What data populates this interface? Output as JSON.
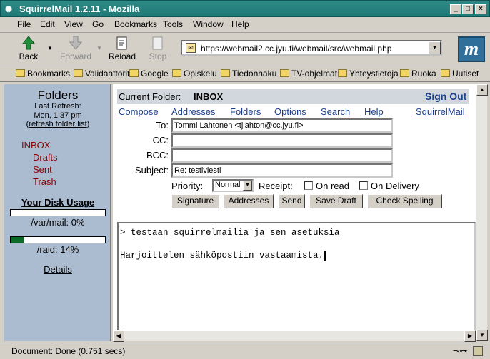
{
  "window": {
    "title": "SquirrelMail 1.2.11 - Mozilla",
    "controls": {
      "minimize": "_",
      "maximize": "□",
      "close": "×"
    }
  },
  "menu": [
    "File",
    "Edit",
    "View",
    "Go",
    "Bookmarks",
    "Tools",
    "Window",
    "Help"
  ],
  "toolbar": {
    "back": "Back",
    "forward": "Forward",
    "reload": "Reload",
    "stop": "Stop",
    "url": "https://webmail2.cc.jyu.fi/webmail/src/webmail.php"
  },
  "bookmarks": [
    "Bookmarks",
    "Validaattorit",
    "Google",
    "Opiskelu",
    "Tiedonhaku",
    "TV-ohjelmat",
    "Yhteystietoja",
    "Ruoka",
    "Uutiset"
  ],
  "sidebar": {
    "title": "Folders",
    "last_refresh_label": "Last Refresh:",
    "last_refresh_time": "Mon, 1:37 pm",
    "refresh_open": "(",
    "refresh_link": "refresh folder list",
    "refresh_close": ")",
    "folders": [
      "INBOX",
      "Drafts",
      "Sent",
      "Trash"
    ],
    "disk_usage_title": "Your Disk Usage",
    "quota1_label": "/var/mail: 0%",
    "quota1_value": 0,
    "quota2_label": "/raid: 14%",
    "quota2_value": 14,
    "details": "Details"
  },
  "header": {
    "current_folder_label": "Current Folder:",
    "current_folder": "INBOX",
    "sign_out": "Sign Out"
  },
  "nav_links": [
    "Compose",
    "Addresses",
    "Folders",
    "Options",
    "Search",
    "Help"
  ],
  "brand_link": "SquirrelMail",
  "compose": {
    "to_label": "To:",
    "to_value": "Tommi Lahtonen <tjlahton@cc.jyu.fi>",
    "cc_label": "CC:",
    "cc_value": "",
    "bcc_label": "BCC:",
    "bcc_value": "",
    "subject_label": "Subject:",
    "subject_value": "Re: testiviesti",
    "priority_label": "Priority:",
    "priority_value": "Normal",
    "receipt_label": "Receipt:",
    "on_read": "On read",
    "on_delivery": "On Delivery",
    "buttons": [
      "Signature",
      "Addresses",
      "Send",
      "Save Draft",
      "Check Spelling"
    ],
    "body_line1": "> testaan squirrelmailia ja sen asetuksia",
    "body_line2": "",
    "body_line3": "Harjoittelen sähköpostiin vastaamista."
  },
  "status": {
    "text": "Document: Done (0.751 secs)"
  }
}
